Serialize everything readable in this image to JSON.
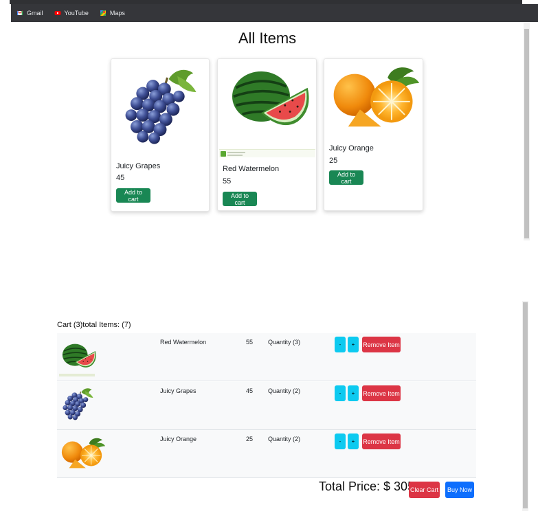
{
  "bookmarks": [
    {
      "label": "Gmail",
      "icon": "gmail-icon"
    },
    {
      "label": "YouTube",
      "icon": "youtube-icon"
    },
    {
      "label": "Maps",
      "icon": "maps-icon"
    }
  ],
  "page_title": "All Items",
  "products": [
    {
      "name": "Juicy Grapes",
      "price": "45",
      "button": "Add to cart",
      "image": "grapes-image"
    },
    {
      "name": "Red Watermelon",
      "price": "55",
      "button": "Add to cart",
      "image": "watermelon-image"
    },
    {
      "name": "Juicy Orange",
      "price": "25",
      "button": "Add to cart",
      "image": "orange-image"
    }
  ],
  "cart": {
    "heading": "Cart (3)total Items: (7)",
    "items": [
      {
        "name": "Red Watermelon",
        "price": "55",
        "quantity": "Quantity (3)",
        "minus": "-",
        "plus": "+",
        "remove": "Remove Item"
      },
      {
        "name": "Juicy Grapes",
        "price": "45",
        "quantity": "Quantity (2)",
        "minus": "-",
        "plus": "+",
        "remove": "Remove Item"
      },
      {
        "name": "Juicy Orange",
        "price": "25",
        "quantity": "Quantity (2)",
        "minus": "-",
        "plus": "+",
        "remove": "Remove Item"
      }
    ],
    "total_label": "Total Price: $",
    "total_value": "305",
    "clear_label": "Clear Cart",
    "buy_label": "Buy Now"
  },
  "colors": {
    "success": "#198754",
    "info": "#0dcaf0",
    "danger": "#dc3545",
    "primary": "#0d6efd",
    "bookmarks_bar": "#35363a"
  }
}
